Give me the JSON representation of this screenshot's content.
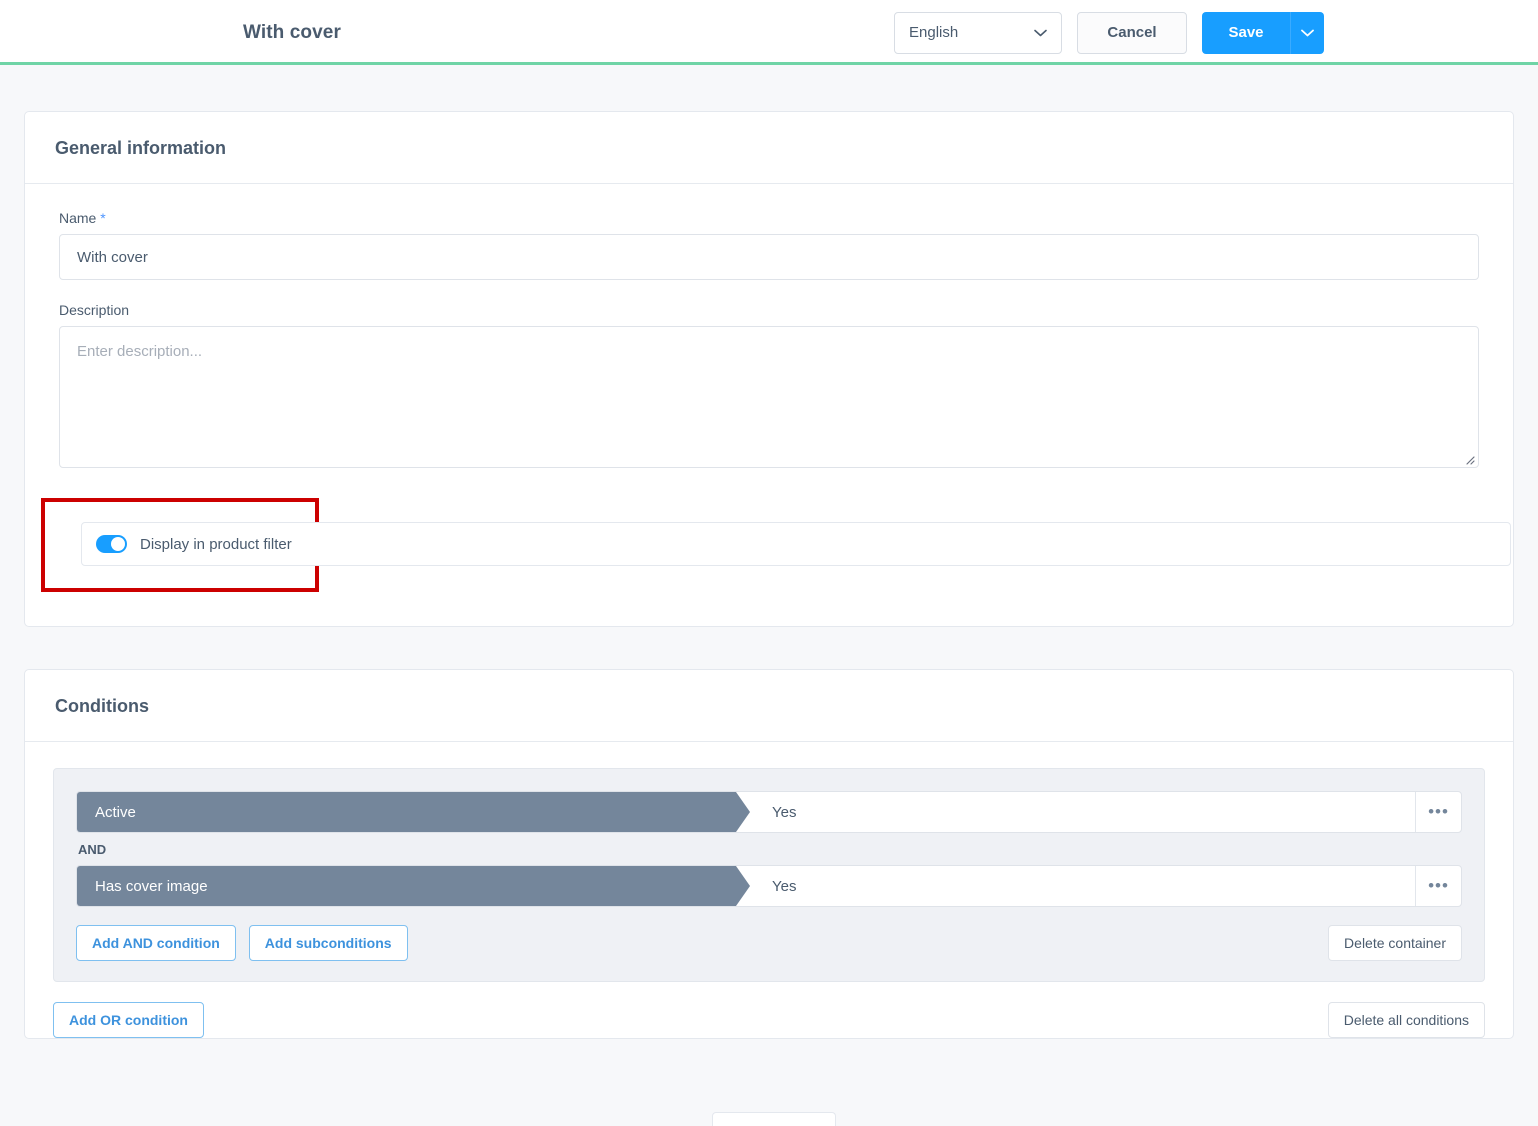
{
  "header": {
    "title": "With cover",
    "language_selected": "English",
    "language_caret_icon": "chevron-down-icon",
    "cancel_label": "Cancel",
    "save_label": "Save",
    "save_caret_icon": "chevron-down-icon",
    "accent_color": "#6fd4a6",
    "primary_color": "#189eff"
  },
  "general": {
    "section_title": "General information",
    "name_label": "Name",
    "name_required_mark": "*",
    "name_value": "With cover",
    "description_label": "Description",
    "description_value": "",
    "description_placeholder": "Enter description...",
    "toggle_label": "Display in product filter",
    "toggle_state": "on",
    "highlight_color": "#cc0000"
  },
  "conditions": {
    "section_title": "Conditions",
    "rows": [
      {
        "field": "Active",
        "value": "Yes",
        "menu_icon": "ellipsis-icon"
      },
      {
        "field": "Has cover image",
        "value": "Yes",
        "menu_icon": "ellipsis-icon"
      }
    ],
    "operator": "AND",
    "add_and_label": "Add AND condition",
    "add_subconditions_label": "Add subconditions",
    "delete_container_label": "Delete container",
    "add_or_label": "Add OR condition",
    "delete_all_label": "Delete all conditions",
    "menu_glyph": "•••"
  }
}
